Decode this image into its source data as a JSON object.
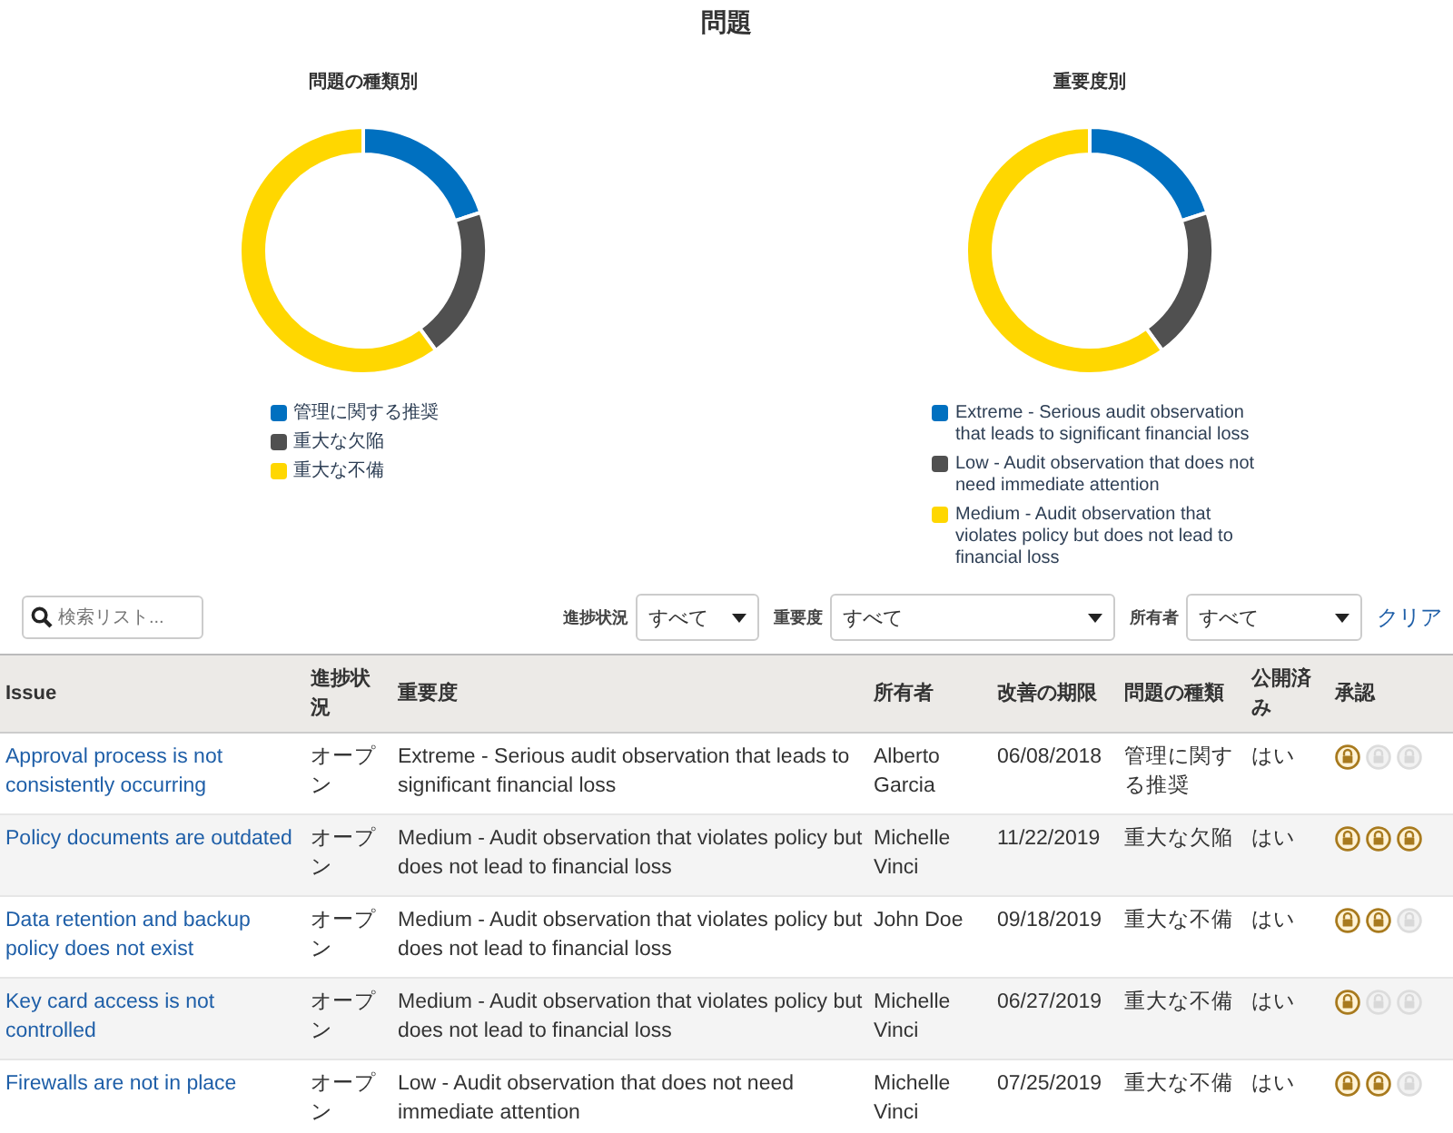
{
  "title": "問題",
  "charts": [
    {
      "chart_data": {
        "type": "donut",
        "title": "問題の種類別",
        "categories": [
          "管理に関する推奨",
          "重大な欠陥",
          "重大な不備"
        ],
        "values": [
          20,
          20,
          60
        ],
        "legend": "bottom",
        "colors": [
          "#0070c0",
          "#505050",
          "#ffd700"
        ]
      }
    },
    {
      "chart_data": {
        "type": "donut",
        "title": "重要度別",
        "categories": [
          "Extreme - Serious audit observation that leads to significant financial loss",
          "Low - Audit observation that does not need immediate attention",
          "Medium - Audit observation that violates policy but does not lead to financial loss"
        ],
        "values": [
          20,
          20,
          60
        ],
        "legend": "bottom",
        "colors": [
          "#0070c0",
          "#505050",
          "#ffd700"
        ]
      }
    }
  ],
  "search": {
    "placeholder": "検索リスト..."
  },
  "filters": [
    {
      "label": "進捗状況",
      "value": "すべて"
    },
    {
      "label": "重要度",
      "value": "すべて"
    },
    {
      "label": "所有者",
      "value": "すべて"
    }
  ],
  "clear_link": "クリア",
  "table": {
    "columns": [
      "Issue",
      "進捗状況",
      "重要度",
      "所有者",
      "改善の期限",
      "問題の種類",
      "公開済み",
      "承認"
    ],
    "rows": [
      {
        "issue": "Approval process is not consistently occurring",
        "status": "オープン",
        "severity": "Extreme - Serious audit observation that leads to significant financial loss",
        "owner": "Alberto Garcia",
        "due": "06/08/2018",
        "type": "管理に関する推奨",
        "published": "はい",
        "approvals": [
          {
            "approved": true
          },
          {
            "approved": false
          },
          {
            "approved": false
          }
        ]
      },
      {
        "issue": "Policy documents are outdated",
        "status": "オープン",
        "severity": "Medium - Audit observation that violates policy but does not lead to financial loss",
        "owner": "Michelle Vinci",
        "due": "11/22/2019",
        "type": "重大な欠陥",
        "published": "はい",
        "approvals": [
          {
            "approved": true
          },
          {
            "approved": true
          },
          {
            "approved": true
          }
        ]
      },
      {
        "issue": "Data retention and backup policy does not exist",
        "status": "オープン",
        "severity": "Medium - Audit observation that violates policy but does not lead to financial loss",
        "owner": "John Doe",
        "due": "09/18/2019",
        "type": "重大な不備",
        "published": "はい",
        "approvals": [
          {
            "approved": true
          },
          {
            "approved": true
          },
          {
            "approved": false
          }
        ]
      },
      {
        "issue": "Key card access is not controlled",
        "status": "オープン",
        "severity": "Medium - Audit observation that violates policy but does not lead to financial loss",
        "owner": "Michelle Vinci",
        "due": "06/27/2019",
        "type": "重大な不備",
        "published": "はい",
        "approvals": [
          {
            "approved": true
          },
          {
            "approved": false
          },
          {
            "approved": false
          }
        ]
      },
      {
        "issue": "Firewalls are not in place",
        "status": "オープン",
        "severity": "Low - Audit observation that does not need immediate attention",
        "owner": "Michelle Vinci",
        "due": "07/25/2019",
        "type": "重大な不備",
        "published": "はい",
        "approvals": [
          {
            "approved": true
          },
          {
            "approved": true
          },
          {
            "approved": false
          }
        ]
      }
    ]
  }
}
